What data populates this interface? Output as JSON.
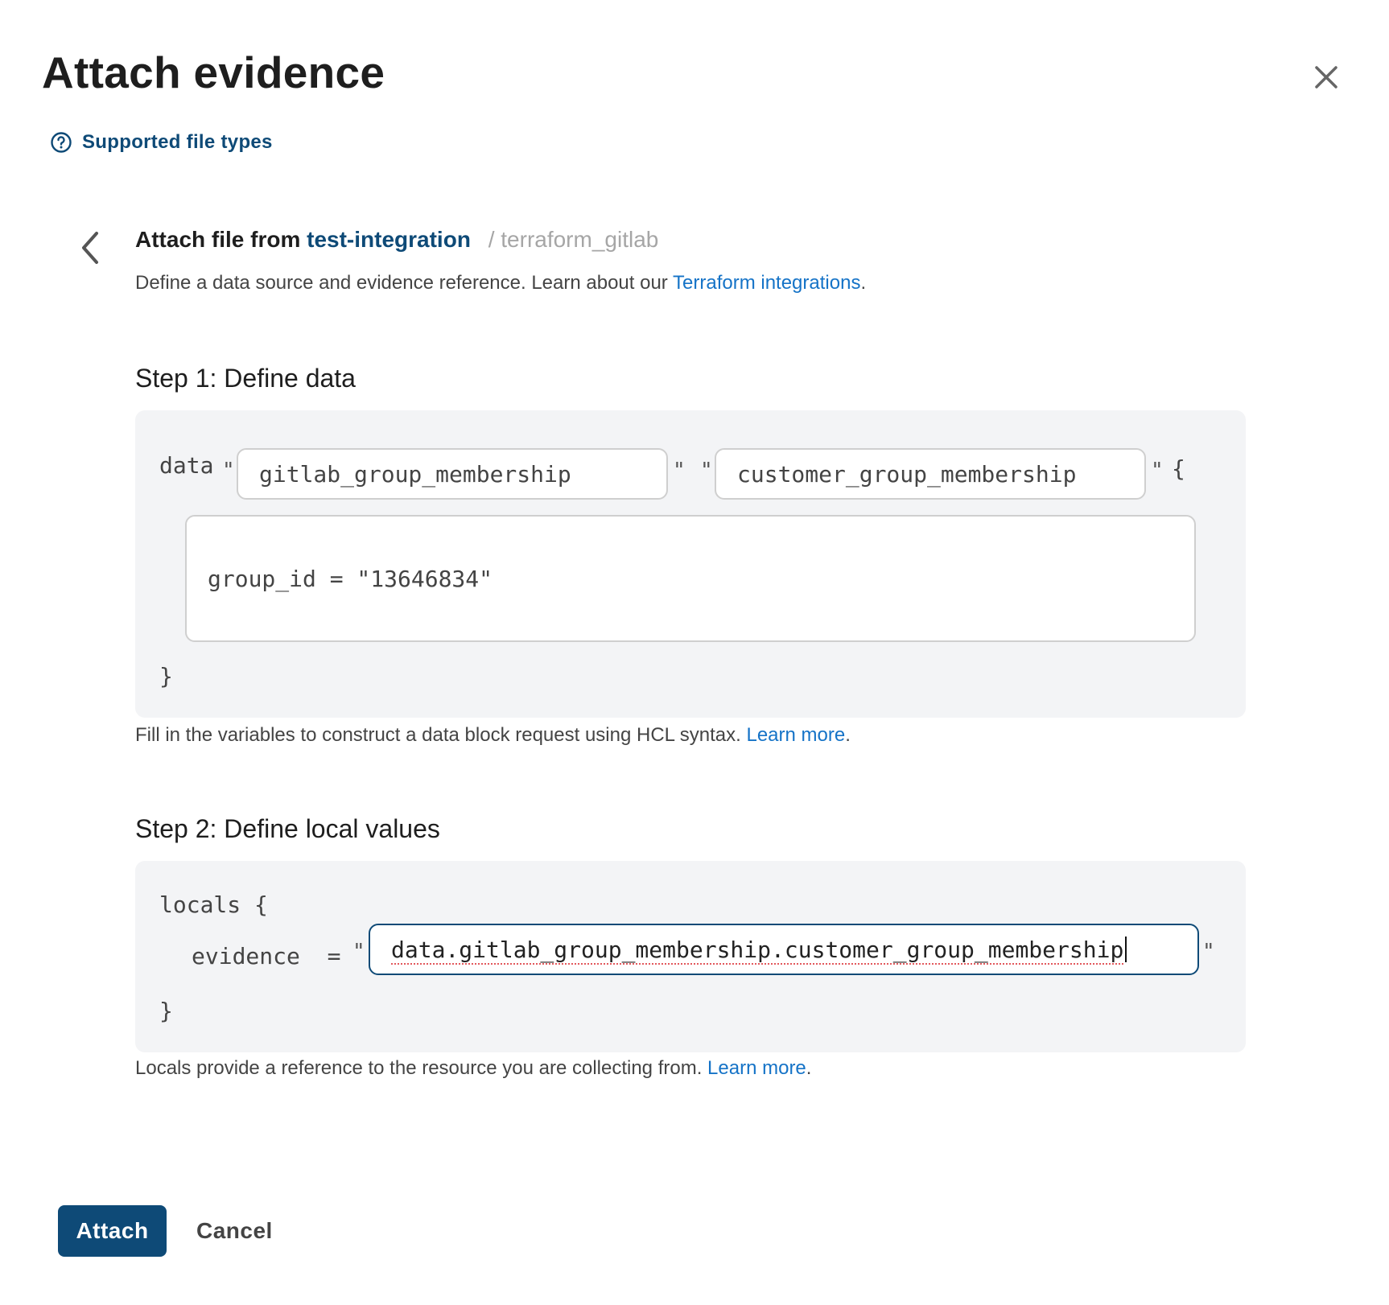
{
  "dialog": {
    "title": "Attach evidence",
    "help_link": "Supported file types"
  },
  "breadcrumb": {
    "label": "Attach file from",
    "integration": "test-integration",
    "path": "/ terraform_gitlab"
  },
  "description": {
    "text": "Define a data source and evidence reference. Learn about our ",
    "link": "Terraform integrations",
    "suffix": "."
  },
  "step1": {
    "title": "Step 1: Define data",
    "keyword": "data",
    "data_source_type": "gitlab_group_membership",
    "data_source_name": "customer_group_membership",
    "open_brace": "{",
    "body": "group_id = \"13646834\"",
    "close_brace": "}",
    "hint": "Fill in the variables to construct a data block request using HCL syntax. ",
    "hint_link": "Learn more",
    "hint_suffix": "."
  },
  "step2": {
    "title": "Step 2: Define local values",
    "keyword": "locals {",
    "evidence_label": "evidence  =",
    "evidence_value": "data.gitlab_group_membership.customer_group_membership",
    "close_brace": "}",
    "hint": "Locals provide a reference to the resource you are collecting from. ",
    "hint_link": "Learn more",
    "hint_suffix": "."
  },
  "quote_char": "\"",
  "actions": {
    "attach": "Attach",
    "cancel": "Cancel"
  }
}
